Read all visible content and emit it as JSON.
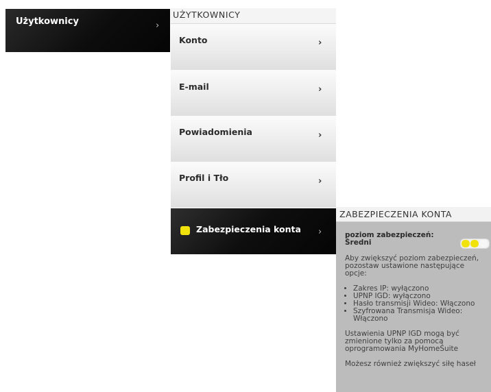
{
  "root_nav": {
    "label": "Użytkownicy",
    "chevron": "›"
  },
  "users_column": {
    "title": "UŻYTKOWNICY",
    "items": [
      {
        "label": "Konto",
        "chevron": "›"
      },
      {
        "label": "E-mail",
        "chevron": "›"
      },
      {
        "label": "Powiadomienia",
        "chevron": "›"
      },
      {
        "label": "Profil i Tło",
        "chevron": "›"
      },
      {
        "label": "Zabezpieczenia konta",
        "chevron": "›"
      }
    ]
  },
  "security_panel": {
    "title": "ZABEZPIECZENIA KONTA",
    "level_label": "poziom zabezpieczeń:",
    "level_value": "Średni",
    "level_fill": 0.67,
    "intro": "Aby zwiększyć poziom zabezpieczeń, pozostaw ustawione następujące opcje:",
    "options": [
      "Zakres IP: wyłączono",
      "UPNP IGD: wyłączono",
      "Hasło transmisji Wideo: Włączono",
      "Szyfrowana Transmisja Wideo: Włączono"
    ],
    "note": "Ustawienia UPNP IGD mogą być zmienione tylko za pomocą oprogramowania MyHomeSuite",
    "footer": "Możesz również zwiększyć siłę haseł"
  },
  "colors": {
    "accent_yellow": "#f1e20c",
    "active_bg": "#0b0b0b",
    "panel_bg": "#bcbcbc"
  }
}
